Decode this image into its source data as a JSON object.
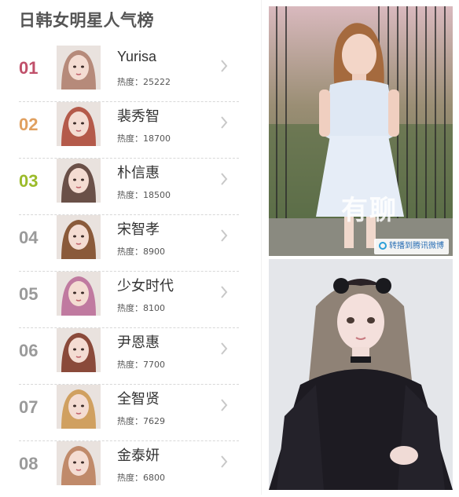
{
  "title": "日韩女明星人气榜",
  "rank_colors": [
    "#c0506a",
    "#e0a060",
    "#9bbb2a",
    "#9a9a9a",
    "#9a9a9a",
    "#9a9a9a",
    "#9a9a9a",
    "#9a9a9a"
  ],
  "heat_label": "热度：",
  "items": [
    {
      "rank": "01",
      "name": "Yurisa",
      "heat": "25222",
      "avatar": "avatar-photo-yurisa"
    },
    {
      "rank": "02",
      "name": "裴秀智",
      "heat": "18700",
      "avatar": "avatar-photo-bae-suzy"
    },
    {
      "rank": "03",
      "name": "朴信惠",
      "heat": "18500",
      "avatar": "avatar-photo-park-shin-hye"
    },
    {
      "rank": "04",
      "name": "宋智孝",
      "heat": "8900",
      "avatar": "avatar-photo-song-ji-hyo"
    },
    {
      "rank": "05",
      "name": "少女时代",
      "heat": "8100",
      "avatar": "avatar-photo-girls-generation"
    },
    {
      "rank": "06",
      "name": "尹恩惠",
      "heat": "7700",
      "avatar": "avatar-photo-yoon-eun-hye"
    },
    {
      "rank": "07",
      "name": "全智贤",
      "heat": "7629",
      "avatar": "avatar-photo-jun-ji-hyun"
    },
    {
      "rank": "08",
      "name": "金泰妍",
      "heat": "6800",
      "avatar": "avatar-photo-kim-tae-yeon"
    }
  ],
  "photos": {
    "top_watermark": "有聊",
    "top_badge": "转播到腾讯微博"
  }
}
